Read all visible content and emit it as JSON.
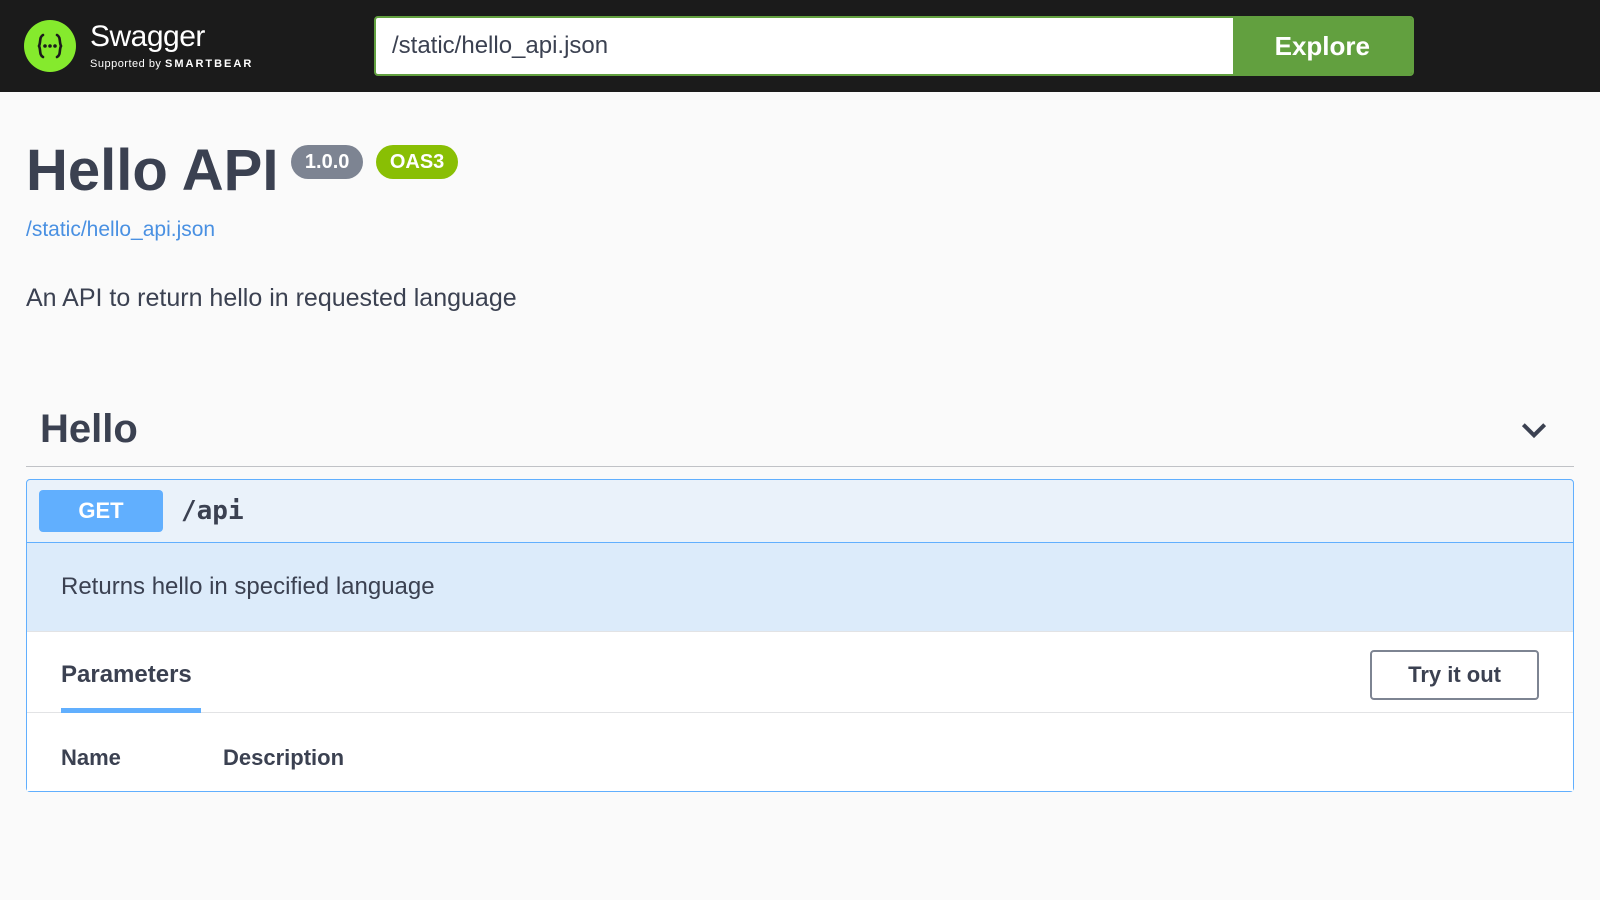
{
  "topbar": {
    "logo_text": "Swagger",
    "logo_sub_prefix": "Supported by ",
    "logo_sub_brand": "SMARTBEAR",
    "input_value": "/static/hello_api.json",
    "explore_label": "Explore"
  },
  "info": {
    "title": "Hello API",
    "version": "1.0.0",
    "oas_badge": "OAS3",
    "spec_url": "/static/hello_api.json",
    "description": "An API to return hello in requested language"
  },
  "tag": {
    "name": "Hello"
  },
  "operation": {
    "method": "GET",
    "path": "/api",
    "description": "Returns hello in specified language",
    "parameters_label": "Parameters",
    "try_label": "Try it out",
    "col_name": "Name",
    "col_desc": "Description"
  }
}
